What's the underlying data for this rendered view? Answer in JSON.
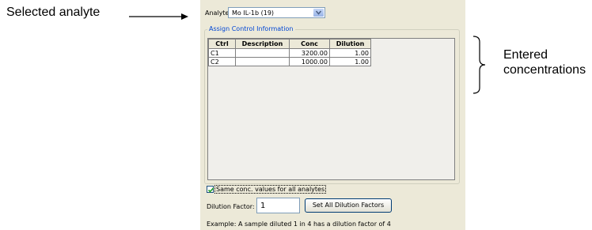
{
  "annotations": {
    "selected_analyte": "Selected analyte",
    "entered_line1": "Entered",
    "entered_line2": "concentrations"
  },
  "dialog": {
    "analyte_label": "Analyte:",
    "analyte_value": "Mo IL-1b (19)",
    "group_title": "Assign Control Information",
    "table": {
      "headers": [
        "Ctrl",
        "Description",
        "Conc",
        "Dilution"
      ],
      "rows": [
        {
          "ctrl": "C1",
          "description": "",
          "conc": "3200.00",
          "dilution": "1.00"
        },
        {
          "ctrl": "C2",
          "description": "",
          "conc": "1000.00",
          "dilution": "1.00"
        }
      ]
    },
    "same_values_label": "Same conc. values for all analytes",
    "same_values_checked": true,
    "dilution_factor_label": "Dilution Factor:",
    "dilution_factor_value": "1",
    "set_all_button": "Set All Dilution Factors",
    "example_text": "Example: A sample diluted 1 in 4 has a dilution factor of 4"
  },
  "colors": {
    "dialog_bg": "#ece9d8",
    "group_title": "#0046d5",
    "input_border": "#7f9db9"
  },
  "icons": {
    "dropdown": "chevron-down-icon",
    "checkbox": "checkmark-icon"
  }
}
